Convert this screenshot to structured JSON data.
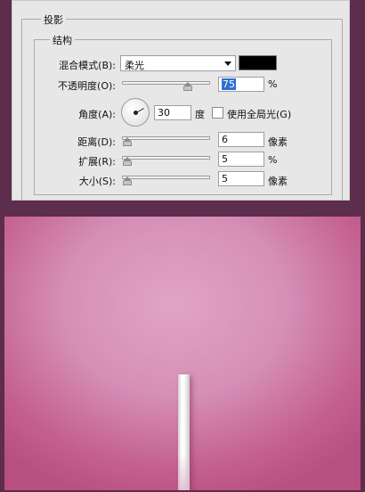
{
  "dialog": {
    "outer_group_title": "投影",
    "inner_group_title": "结构",
    "blend_mode": {
      "label": "混合模式(B):",
      "value": "柔光",
      "color": "#000000"
    },
    "opacity": {
      "label": "不透明度(O):",
      "value": "75",
      "unit": "%",
      "level": 0.75
    },
    "angle": {
      "label": "角度(A):",
      "value": "30",
      "unit": "度",
      "global_light_label": "使用全局光(G)",
      "global_light_checked": false
    },
    "distance": {
      "label": "距离(D):",
      "value": "6",
      "unit": "像素"
    },
    "spread": {
      "label": "扩展(R):",
      "value": "5",
      "unit": "%"
    },
    "size": {
      "label": "大小(S):",
      "value": "5",
      "unit": "像素"
    }
  },
  "preview": {
    "background_color": "#d58fb6",
    "object": "white-rod"
  }
}
